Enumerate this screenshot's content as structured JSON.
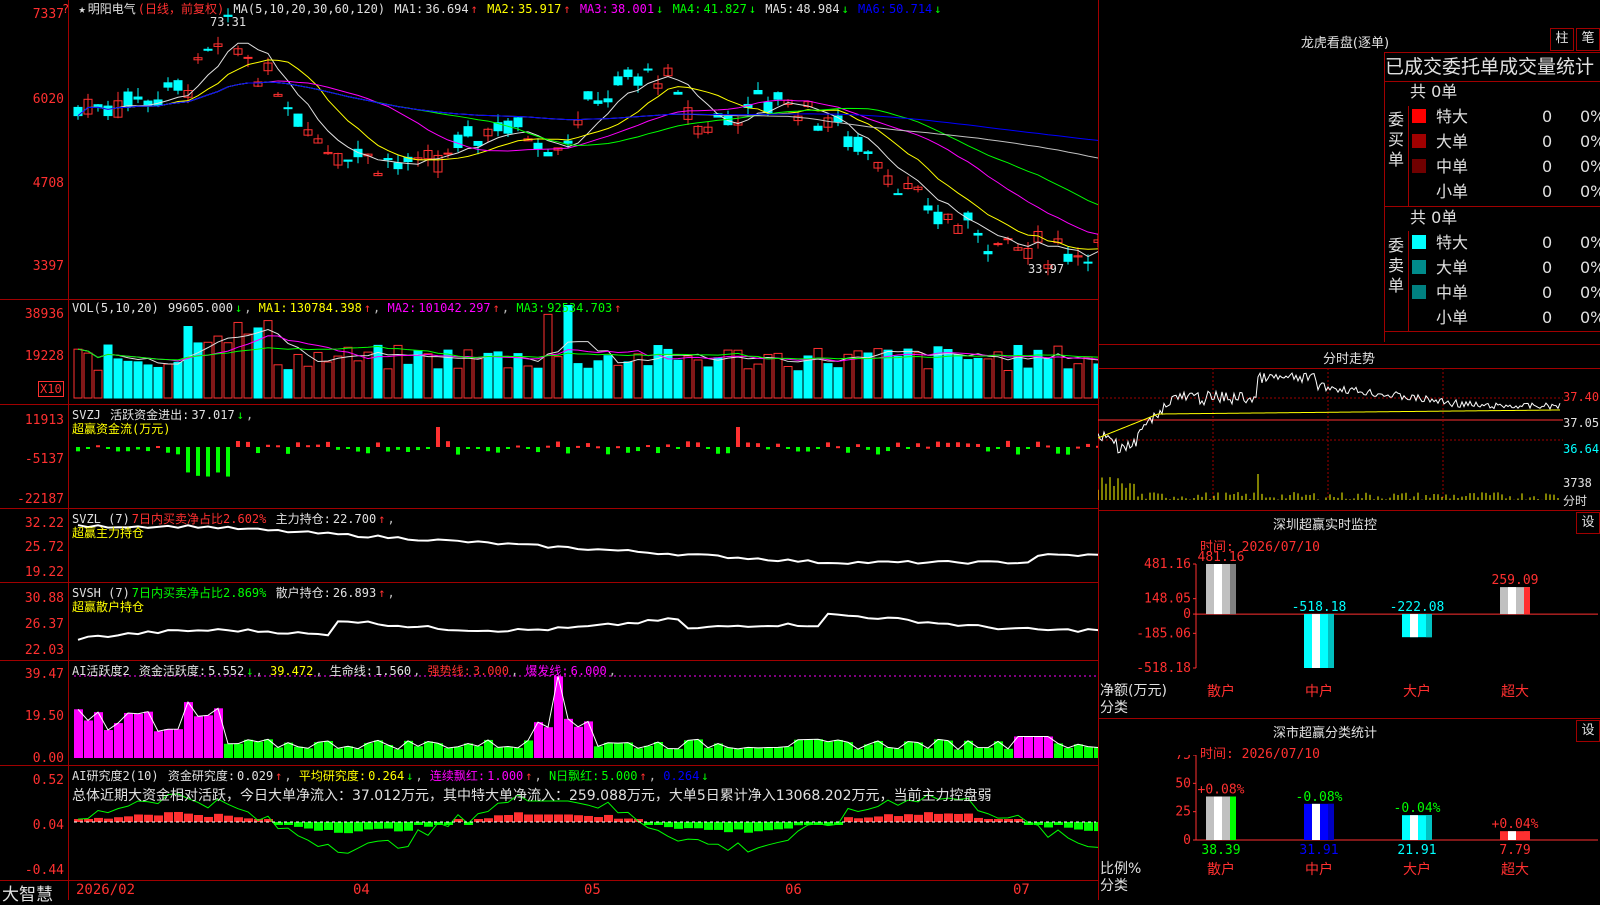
{
  "colors": {
    "up": "#ff3030",
    "down": "#00ffff",
    "grid": "#a00000",
    "ma1": "#e0e0e0",
    "ma2": "#ffff00",
    "ma3": "#ff00ff",
    "ma4": "#00ff00",
    "ma5": "#c0c0c0",
    "ma6": "#0000ff",
    "green": "#00ff00",
    "magenta": "#ff00ff"
  },
  "header": {
    "star": "★",
    "name": "明阳电气",
    "period": "(日线，前复权)",
    "ma_head": "MA(5,10,20,30,60,120)",
    "ma_values": [
      {
        "label": "MA1:",
        "value": "36.694",
        "dir": "↑"
      },
      {
        "label": "MA2:",
        "value": "35.917",
        "dir": "↑"
      },
      {
        "label": "MA3:",
        "value": "38.001",
        "dir": "↓"
      },
      {
        "label": "MA4:",
        "value": "41.827",
        "dir": "↓"
      },
      {
        "label": "MA5:",
        "value": "48.984",
        "dir": "↓"
      },
      {
        "label": "MA6:",
        "value": "50.714",
        "dir": "↓"
      }
    ],
    "high_mark": "73.31",
    "low_mark": "33.97",
    "corner_icon": "?"
  },
  "price_axis": [
    "7337",
    "6020",
    "4708",
    "3397"
  ],
  "vol": {
    "legend": "VOL(5,10,20)",
    "value": "99605.000",
    "value_dir": "↓",
    "ma": [
      {
        "label": "MA1:",
        "value": "130784.398",
        "dir": "↑"
      },
      {
        "label": "MA2:",
        "value": "101042.297",
        "dir": "↑"
      },
      {
        "label": "MA3:",
        "value": "92534.703",
        "dir": "↑"
      }
    ],
    "axis": [
      "38936",
      "19228"
    ],
    "unit": "X10"
  },
  "svzj": {
    "legend": "SVZJ",
    "title": "活跃资金进出:",
    "value": "37.017",
    "dir": "↓",
    "sub": "超赢资金流(万元)",
    "axis": [
      "11913",
      "-5137",
      "-22187"
    ]
  },
  "svzl": {
    "legend": "SVZL (7)",
    "pct": "7日内买卖净占比2.602%",
    "title": "主力持仓:",
    "value": "22.700",
    "dir": "↑",
    "sub": "超赢主力持仓",
    "axis": [
      "32.22",
      "25.72",
      "19.22"
    ]
  },
  "svsh": {
    "legend": "SVSH (7)",
    "pct": "7日内买卖净占比2.869%",
    "title": "散户持仓:",
    "value": "26.893",
    "dir": "↑",
    "sub": "超赢散户持仓",
    "axis": [
      "30.88",
      "26.37",
      "22.03"
    ]
  },
  "ai1": {
    "legend": "AI活跃度2",
    "t1": "资金活跃度:",
    "v1": "5.552",
    "d1": "↓",
    "v2": "39.472",
    "t3": "生命线:",
    "v3": "1.560",
    "t4": "强势线:",
    "v4": "3.000",
    "t5": "爆发线:",
    "v5": "6.000",
    "axis": [
      "39.47",
      "19.50",
      "0.00"
    ]
  },
  "ai2": {
    "legend": "AI研究度2(10)",
    "t1": "资金研究度:",
    "v1": "0.029",
    "d1": "↑",
    "t2": "平均研究度:",
    "v2": "0.264",
    "d2": "↓",
    "t3": "连续飘红:",
    "v3": "1.000",
    "d3": "↑",
    "t4": "N日飘红:",
    "v4": "5.000",
    "d4": "↑",
    "v5": "0.264",
    "d5": "↓",
    "summary": "总体近期大资金相对活跃，今日大单净流入：37.012万元，其中特大单净流入：259.088万元，大单5日累计净入13068.202万元，当前主力控盘弱",
    "axis": [
      "0.52",
      "0.04",
      "-0.44"
    ]
  },
  "xaxis": [
    "2026/02",
    "04",
    "05",
    "06",
    "07"
  ],
  "brand": "大智慧",
  "lhb": {
    "title": "龙虎看盘(逐单)",
    "btn1": "柱",
    "btn2": "笔",
    "subtitle": "已成交委托单成交量统计",
    "buy_label": "委买单",
    "sell_label": "委卖单",
    "buy_total": "共 0单",
    "sell_total": "共 0单",
    "buy_rows": [
      {
        "label": "特大",
        "v": "0",
        "p": "0%",
        "c": "#ff0000"
      },
      {
        "label": "大单",
        "v": "0",
        "p": "0%",
        "c": "#a00000"
      },
      {
        "label": "中单",
        "v": "0",
        "p": "0%",
        "c": "#700000"
      },
      {
        "label": "小单",
        "v": "0",
        "p": "0%",
        "c": ""
      }
    ],
    "sell_rows": [
      {
        "label": "特大",
        "v": "0",
        "p": "0%",
        "c": "#00ffff"
      },
      {
        "label": "大单",
        "v": "0",
        "p": "0%",
        "c": "#008b8b"
      },
      {
        "label": "中单",
        "v": "0",
        "p": "0%",
        "c": "#008080"
      },
      {
        "label": "小单",
        "v": "0",
        "p": "0%",
        "c": ""
      }
    ]
  },
  "fenshi": {
    "title": "分时走势",
    "axis": [
      "37.40",
      "37.05",
      "36.64",
      "3738"
    ],
    "unit": "分时"
  },
  "monitor": {
    "title": "深圳超赢实时监控",
    "btn": "设",
    "time": "时间: 2026/07/10",
    "axis": [
      "481.16",
      "148.05",
      "0",
      "-185.06",
      "-518.18"
    ],
    "ylab1": "净额(万元)",
    "ylab2": "分类",
    "bars": [
      {
        "cat": "散户",
        "value": 481.16,
        "label": "481.16"
      },
      {
        "cat": "中户",
        "value": -518.18,
        "label": "-518.18"
      },
      {
        "cat": "大户",
        "value": -222.08,
        "label": "-222.08"
      },
      {
        "cat": "超大",
        "value": 259.09,
        "label": "259.09"
      }
    ]
  },
  "stats": {
    "title": "深市超赢分类统计",
    "btn": "设",
    "time": "时间: 2026/07/10",
    "axis": [
      "75",
      "50",
      "25",
      "0"
    ],
    "ylab1": "比例%",
    "ylab2": "分类",
    "bars": [
      {
        "cat": "散户",
        "value": 38.39,
        "label": "38.39",
        "change": "+0.08%"
      },
      {
        "cat": "中户",
        "value": 31.91,
        "label": "31.91",
        "change": "-0.08%"
      },
      {
        "cat": "大户",
        "value": 21.91,
        "label": "21.91",
        "change": "-0.04%"
      },
      {
        "cat": "超大",
        "value": 7.79,
        "label": "7.79",
        "change": "+0.04%"
      }
    ]
  },
  "chart_data": [
    {
      "type": "bar",
      "title": "深圳超赢实时监控",
      "ylabel": "净额(万元)",
      "xlabel": "分类",
      "categories": [
        "散户",
        "中户",
        "大户",
        "超大"
      ],
      "values": [
        481.16,
        -518.18,
        -222.08,
        259.09
      ],
      "ylim": [
        -518.18,
        481.16
      ]
    },
    {
      "type": "bar",
      "title": "深市超赢分类统计",
      "ylabel": "比例%",
      "xlabel": "分类",
      "categories": [
        "散户",
        "中户",
        "大户",
        "超大"
      ],
      "values": [
        38.39,
        31.91,
        21.91,
        7.79
      ],
      "ylim": [
        0,
        75
      ]
    }
  ]
}
